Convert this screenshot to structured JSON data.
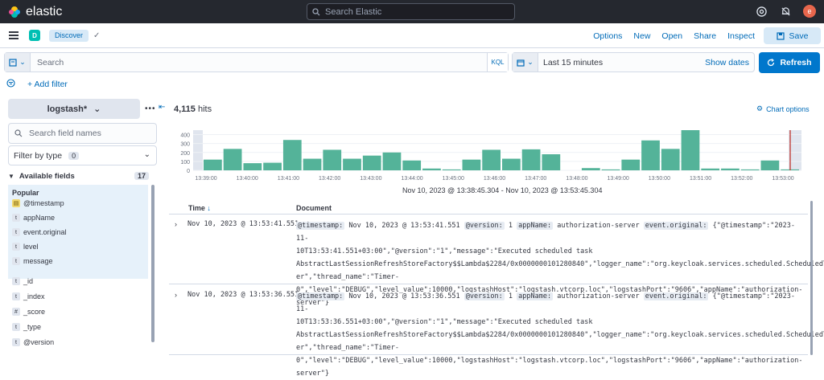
{
  "topbar": {
    "brand": "elastic",
    "search_placeholder": "Search Elastic",
    "avatar_initial": "e"
  },
  "appbar": {
    "app_badge": "D",
    "breadcrumb": "Discover",
    "links": [
      "Options",
      "New",
      "Open",
      "Share",
      "Inspect"
    ],
    "save_label": "Save"
  },
  "query": {
    "search_placeholder": "Search",
    "language": "KQL",
    "time_range": "Last 15 minutes",
    "show_dates": "Show dates",
    "refresh_label": "Refresh",
    "add_filter": "+ Add filter"
  },
  "sidebar": {
    "index_pattern": "logstash*",
    "field_search_placeholder": "Search field names",
    "filter_by_type": "Filter by type",
    "filter_count": "0",
    "available_fields_label": "Available fields",
    "available_count": "17",
    "popular_label": "Popular",
    "popular_fields": [
      {
        "type": "date",
        "name": "@timestamp"
      },
      {
        "type": "t",
        "name": "appName"
      },
      {
        "type": "t",
        "name": "event.original"
      },
      {
        "type": "t",
        "name": "level"
      },
      {
        "type": "t",
        "name": "message"
      }
    ],
    "other_fields": [
      {
        "type": "t",
        "name": "_id"
      },
      {
        "type": "t",
        "name": "_index"
      },
      {
        "type": "#",
        "name": "_score"
      },
      {
        "type": "t",
        "name": "_type"
      },
      {
        "type": "t",
        "name": "@version"
      }
    ]
  },
  "main": {
    "hits_count": "4,115",
    "hits_label": "hits",
    "chart_options": "Chart options",
    "range_label": "Nov 10, 2023 @ 13:38:45.304 - Nov 10, 2023 @ 13:53:45.304",
    "col_time": "Time",
    "col_document": "Document",
    "rows": [
      {
        "time": "Nov 10, 2023 @ 13:53:41.551",
        "k_timestamp": "@timestamp:",
        "v_timestamp": "Nov 10, 2023 @ 13:53:41.551",
        "k_version": "@version:",
        "v_version": "1",
        "k_app": "appName:",
        "v_app": "authorization-server",
        "k_event": "event.original:",
        "line1": "{\"@timestamp\":\"2023-11-",
        "line2": "10T13:53:41.551+03:00\",\"@version\":\"1\",\"message\":\"Executed scheduled task",
        "line3": "AbstractLastSessionRefreshStoreFactory$$Lambda$2284/0x0000000101280840\",\"logger_name\":\"org.keycloak.services.scheduled.ScheduledTaskRunn",
        "line4": "er\",\"thread_name\":\"Timer-",
        "line5": "0\",\"level\":\"DEBUG\",\"level_value\":10000,\"logstashHost\":\"logstash.vtcorp.loc\",\"logstashPort\":\"9606\",\"appName\":\"authorization-server\"}"
      },
      {
        "time": "Nov 10, 2023 @ 13:53:36.551",
        "k_timestamp": "@timestamp:",
        "v_timestamp": "Nov 10, 2023 @ 13:53:36.551",
        "k_version": "@version:",
        "v_version": "1",
        "k_app": "appName:",
        "v_app": "authorization-server",
        "k_event": "event.original:",
        "line1": "{\"@timestamp\":\"2023-11-",
        "line2": "10T13:53:36.551+03:00\",\"@version\":\"1\",\"message\":\"Executed scheduled task",
        "line3": "AbstractLastSessionRefreshStoreFactory$$Lambda$2284/0x0000000101280840\",\"logger_name\":\"org.keycloak.services.scheduled.ScheduledTaskRunn",
        "line4": "er\",\"thread_name\":\"Timer-",
        "line5": "0\",\"level\":\"DEBUG\",\"level_value\":10000,\"logstashHost\":\"logstash.vtcorp.loc\",\"logstashPort\":\"9606\",\"appName\":\"authorization-server\"}"
      }
    ]
  },
  "chart_data": {
    "type": "bar",
    "yticks": [
      0,
      100,
      200,
      300,
      400
    ],
    "ylim": [
      0,
      450
    ],
    "xticks": [
      "13:39:00",
      "13:40:00",
      "13:41:00",
      "13:42:00",
      "13:43:00",
      "13:44:00",
      "13:45:00",
      "13:46:00",
      "13:47:00",
      "13:48:00",
      "13:49:00",
      "13:50:00",
      "13:51:00",
      "13:52:00",
      "13:53:00"
    ],
    "values": [
      120,
      240,
      80,
      85,
      340,
      130,
      230,
      130,
      165,
      200,
      110,
      20,
      10,
      120,
      230,
      130,
      235,
      180,
      0,
      25,
      10,
      120,
      335,
      240,
      450,
      20,
      20,
      10,
      110,
      10
    ],
    "bar_color": "#54b399",
    "grid": true
  }
}
